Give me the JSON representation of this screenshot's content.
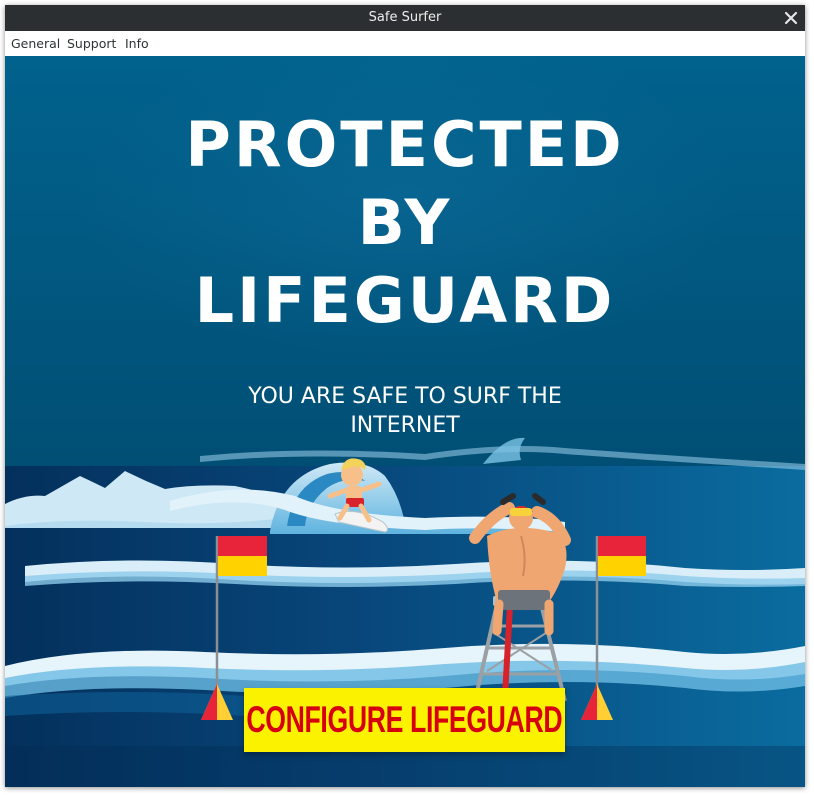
{
  "window": {
    "title": "Safe Surfer"
  },
  "menu": {
    "items": [
      "General",
      "Support",
      "Info"
    ]
  },
  "hero": {
    "headline": [
      "PROTECTED",
      "BY",
      "LIFEGUARD"
    ],
    "subtitle": [
      "YOU ARE SAFE TO SURF THE",
      "INTERNET"
    ]
  },
  "cta": {
    "label": "CONFIGURE LIFEGUARD"
  },
  "icons": {
    "close": "close-icon"
  },
  "colors": {
    "sky": "#015780",
    "sea_dark": "#06305a",
    "sea_light": "#0a6a9c",
    "cta_bg": "#fbf200",
    "cta_text": "#d7000f",
    "flag_red": "#e8243b",
    "flag_yellow": "#ffd200"
  }
}
